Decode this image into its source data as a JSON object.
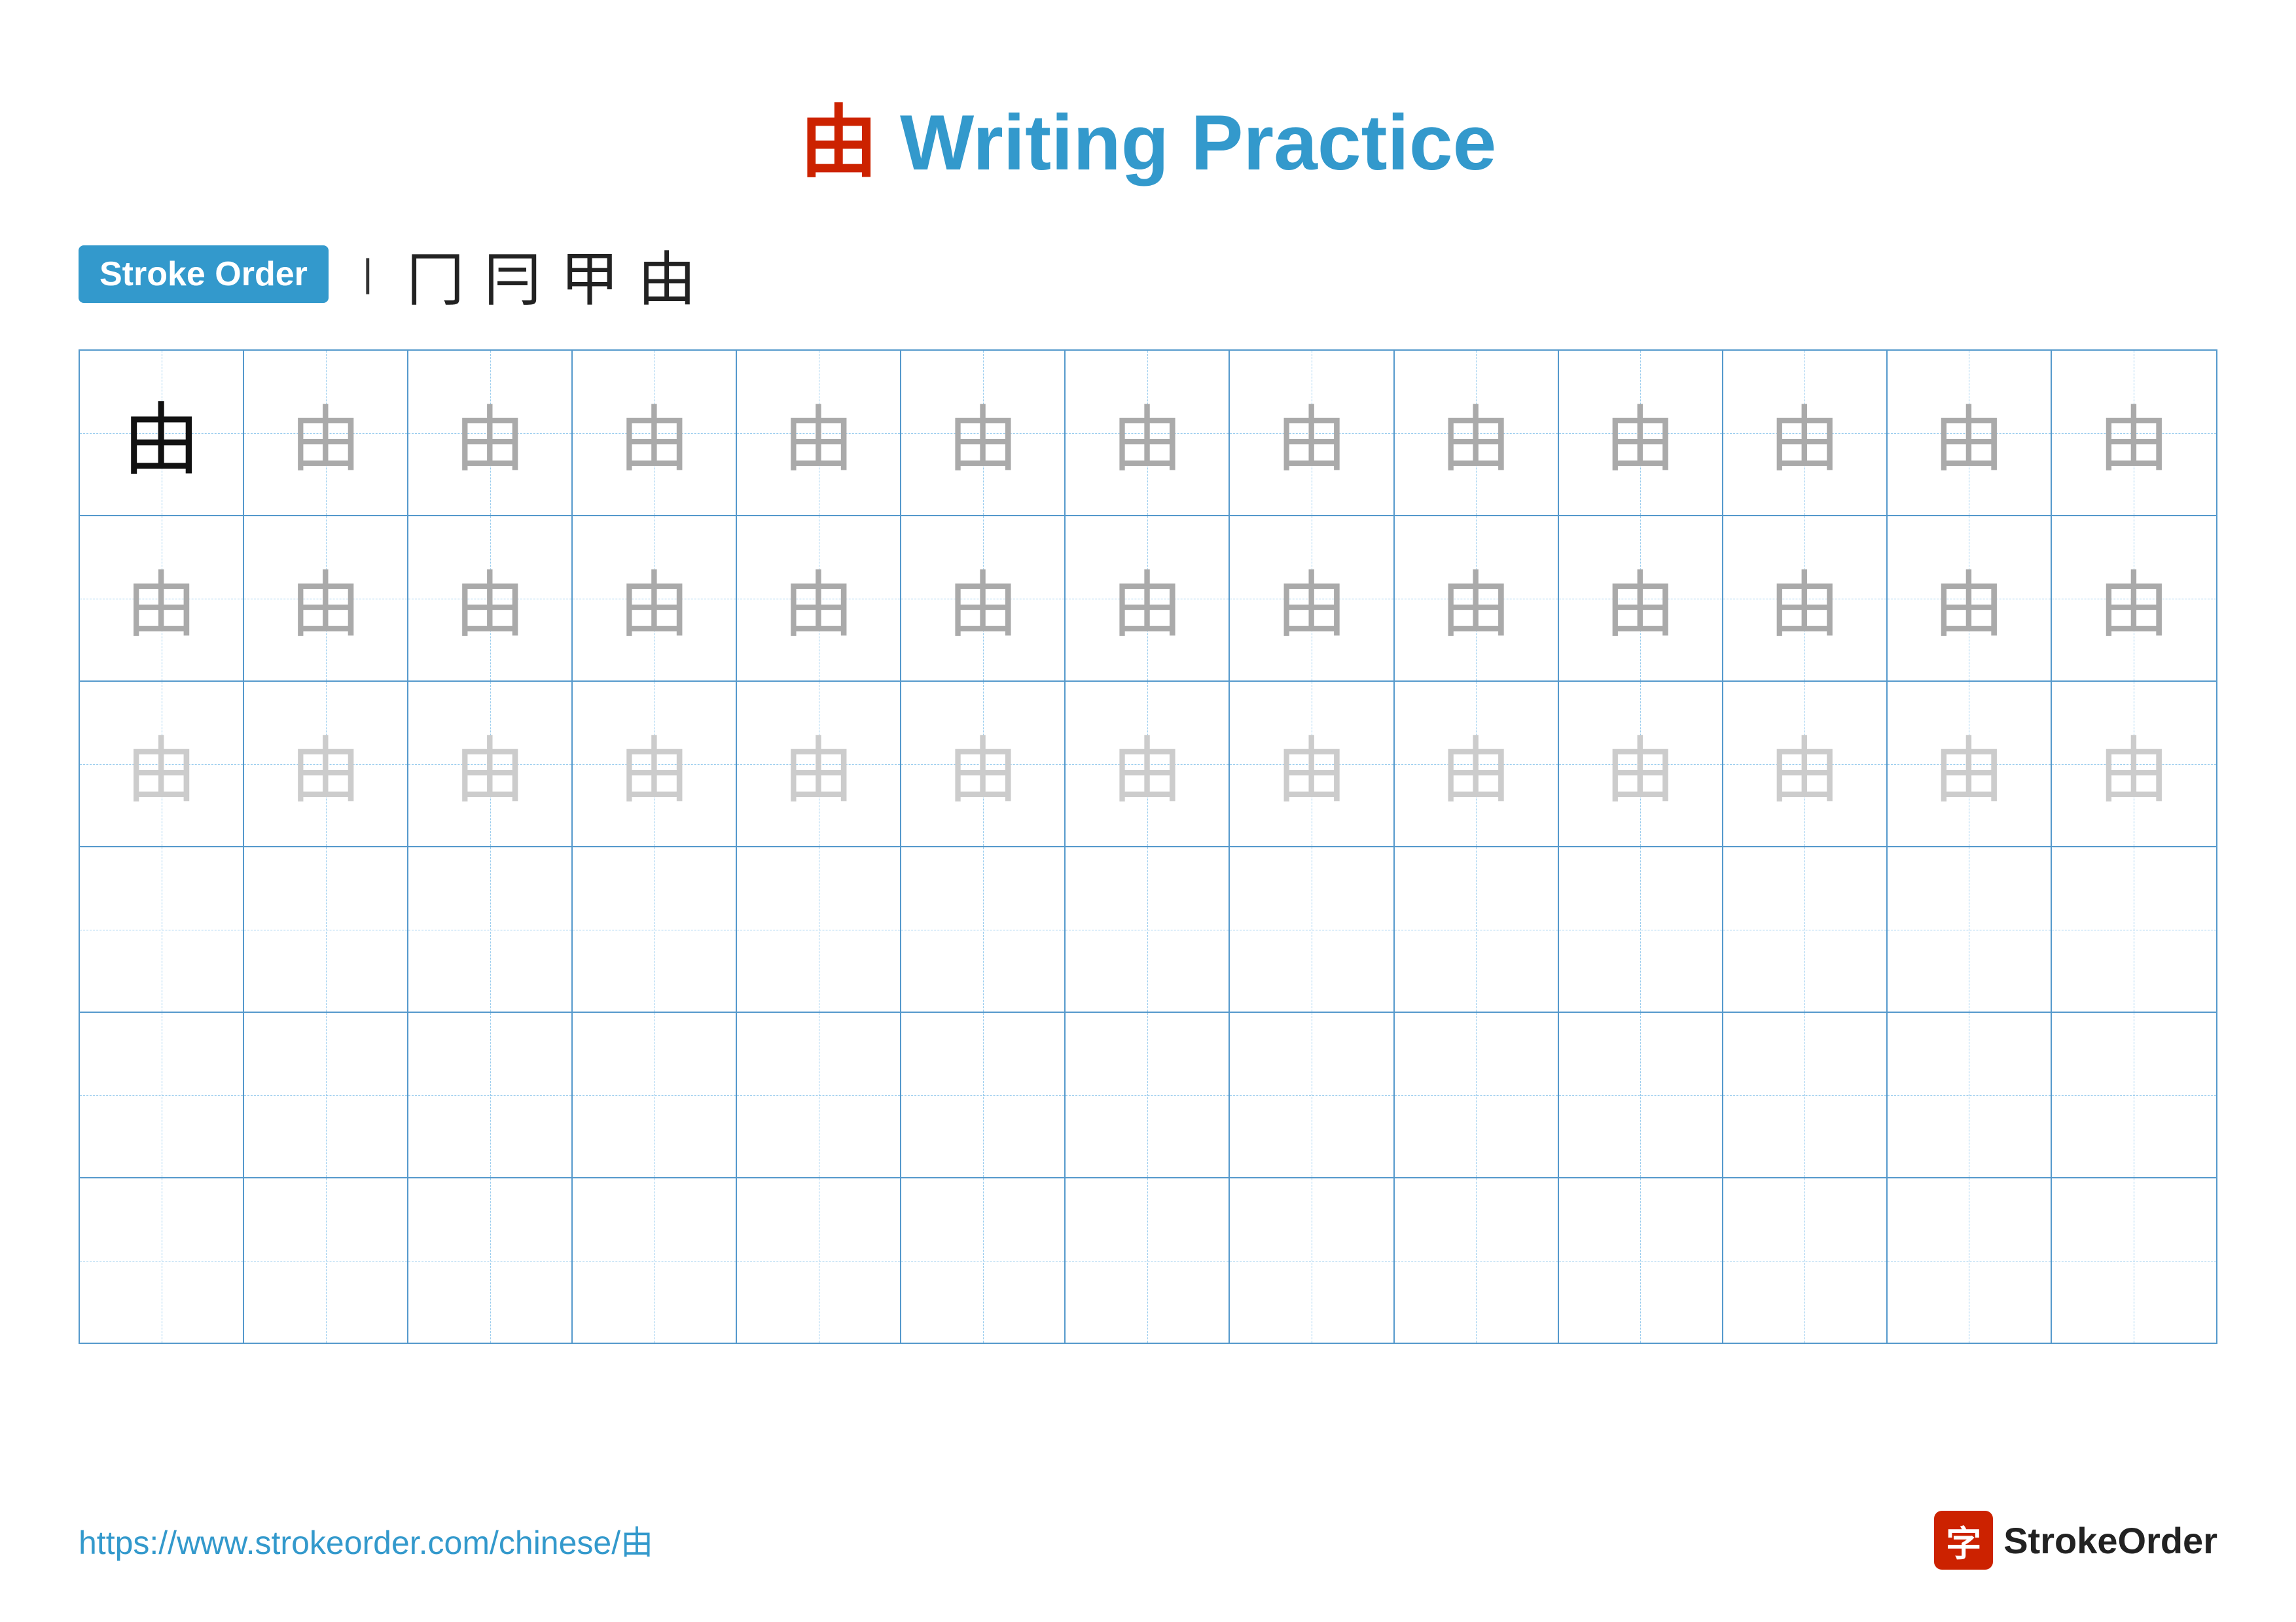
{
  "title": {
    "char": "由",
    "text": "Writing Practice"
  },
  "stroke_order": {
    "badge_label": "Stroke Order",
    "steps": [
      "丨",
      "冂",
      "冃",
      "甲",
      "由"
    ]
  },
  "grid": {
    "rows": 6,
    "cols": 13,
    "char": "由",
    "row_styles": [
      "dark",
      "mid",
      "light",
      "empty",
      "empty",
      "empty"
    ]
  },
  "footer": {
    "url": "https://www.strokeorder.com/chinese/由",
    "logo_char": "字",
    "logo_text": "StrokeOrder"
  }
}
